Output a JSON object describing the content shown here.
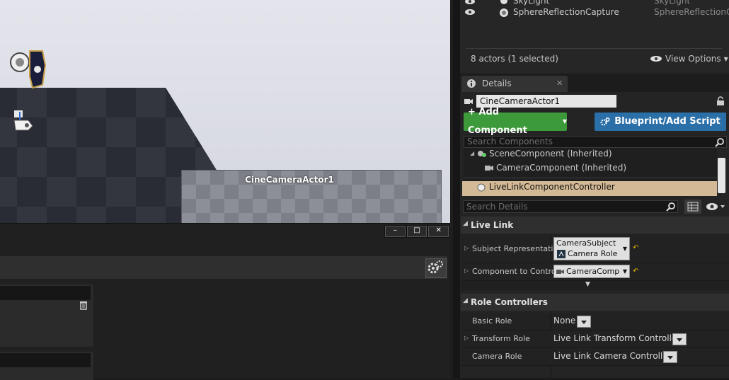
{
  "viewport": {
    "camera_label": "CineCameraActor1"
  },
  "window_controls": {
    "minimize": "–",
    "maximize": "□",
    "close": "✕"
  },
  "outliner": {
    "rows": [
      {
        "name": "SkyLight",
        "type": "SkyLight"
      },
      {
        "name": "SphereReflectionCapture",
        "type": "SphereReflectionC"
      }
    ],
    "actor_count": "8 actors (1 selected)",
    "view_options": "View Options"
  },
  "details": {
    "tab_label": "Details",
    "tab_close": "✕",
    "actor_name": "CineCameraActor1",
    "add_component": "+ Add Component",
    "blueprint_button": "Blueprint/Add Script",
    "search_components_placeholder": "Search Components",
    "components": [
      {
        "label": "SceneComponent (Inherited)"
      },
      {
        "label": "CameraComponent (Inherited)"
      },
      {
        "label": "LiveLinkComponentController"
      }
    ],
    "search_details_placeholder": "Search Details",
    "live_link": {
      "title": "Live Link",
      "subject_label": "Subject Representatic",
      "subject_value": "CameraSubject",
      "subject_role": "Camera Role",
      "component_label": "Component to Control",
      "component_value": "CameraCompor"
    },
    "role_controllers": {
      "title": "Role Controllers",
      "basic_label": "Basic Role",
      "basic_value": "None",
      "transform_label": "Transform Role",
      "transform_value": "Live Link Transform Controller",
      "camera_label": "Camera Role",
      "camera_value": "Live Link Camera Controller"
    }
  },
  "colors": {
    "accent_green": "#3c9a3a",
    "accent_blue": "#2b6fa8",
    "selection": "#d3b995"
  }
}
